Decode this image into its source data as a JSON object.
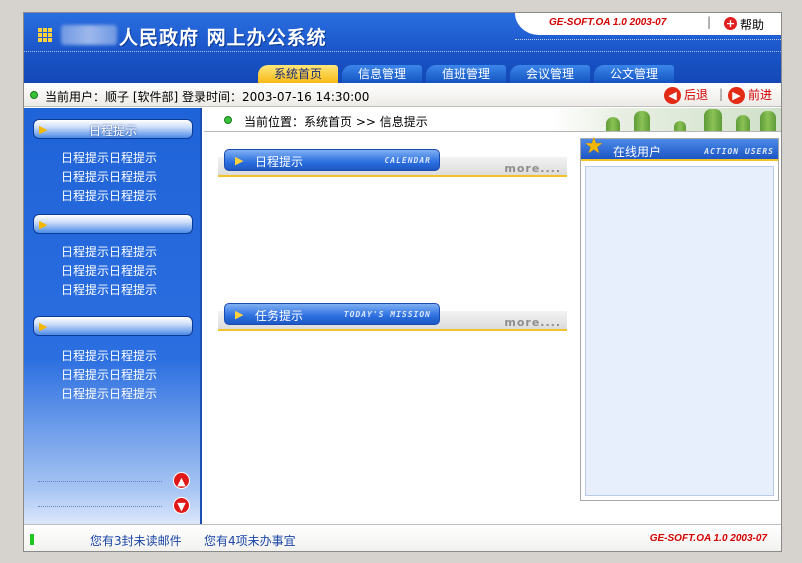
{
  "header": {
    "title": "人民政府 网上办公系统",
    "version": "GE-SOFT.OA 1.0  2003-07",
    "help_label": "帮助",
    "help_icon": "plus-circle-icon",
    "logo_icon": "grid-dots-icon"
  },
  "tabs": [
    {
      "label": "系统首页",
      "active": true
    },
    {
      "label": "信息管理",
      "active": false
    },
    {
      "label": "值班管理",
      "active": false
    },
    {
      "label": "会议管理",
      "active": false
    },
    {
      "label": "公文管理",
      "active": false
    }
  ],
  "infobar": {
    "current_user": "当前用户：顺子 [软件部] 登录时间：2003-07-16 14:30:00",
    "back_label": "后退",
    "forward_label": "前进"
  },
  "sidebar": {
    "groups": [
      {
        "header": "日程提示",
        "items": [
          "日程提示日程提示",
          "日程提示日程提示",
          "日程提示日程提示"
        ]
      },
      {
        "header": "",
        "items": [
          "日程提示日程提示",
          "日程提示日程提示",
          "日程提示日程提示"
        ]
      },
      {
        "header": "",
        "items": [
          "日程提示日程提示",
          "日程提示日程提示",
          "日程提示日程提示"
        ]
      }
    ],
    "scroll_up_icon": "arrow-up-circle-icon",
    "scroll_down_icon": "arrow-down-circle-icon"
  },
  "main": {
    "location": "当前位置：系统首页 >> 信息提示",
    "sections": [
      {
        "title": "日程提示",
        "subtitle_en": "CALENDAR",
        "more": "more...."
      },
      {
        "title": "任务提示",
        "subtitle_en": "TODAY'S MISSION",
        "more": "more...."
      }
    ]
  },
  "online_users": {
    "title": "在线用户",
    "subtitle_en": "ACTION USERS",
    "icon": "star-icon"
  },
  "footer": {
    "unread_mail": "您有3封未读邮件",
    "pending_tasks": "您有4项未办事宜",
    "version": "GE-SOFT.OA 1.0  2003-07"
  },
  "colors": {
    "brand_blue": "#1a55c8",
    "accent_red": "#d40000",
    "tab_active": "#f7b916",
    "section_underline": "#f1c22a"
  }
}
